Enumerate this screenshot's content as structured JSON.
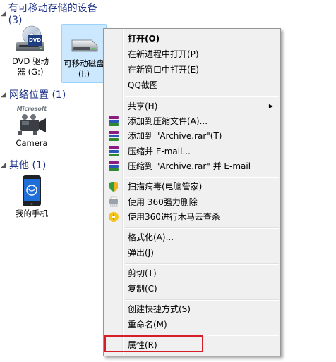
{
  "groups": [
    {
      "id": "removable",
      "label": "有可移动存储的设备 (3)"
    },
    {
      "id": "network",
      "label": "网络位置 (1)"
    },
    {
      "id": "other",
      "label": "其他 (1)"
    }
  ],
  "devices": {
    "dvd": {
      "line1": "DVD 驱动",
      "line2": "器 (G:)",
      "badge": "DVD"
    },
    "removable": {
      "line1": "可移动磁盘",
      "line2": "(I:)"
    },
    "camera": {
      "label": "Camera",
      "logo": "Microsoft"
    },
    "phone": {
      "label": "我的手机"
    }
  },
  "context_menu": {
    "items": {
      "open": "打开(O)",
      "open_new_process": "在新进程中打开(P)",
      "open_new_window": "在新窗口中打开(E)",
      "qq_screenshot": "QQ截图",
      "share": "共享(H)",
      "add_to_archive": "添加到压缩文件(A)...",
      "add_to_archive_rar": "添加到 \"Archive.rar\"(T)",
      "compress_email": "压缩并 E-mail...",
      "compress_rar_email": "压缩到 \"Archive.rar\" 并 E-mail",
      "scan_virus": "扫描病毒(电脑管家)",
      "force_delete_360": "使用 360强力删除",
      "trojan_scan_360": "使用360进行木马云查杀",
      "format": "格式化(A)...",
      "eject": "弹出(J)",
      "cut": "剪切(T)",
      "copy": "复制(C)",
      "create_shortcut": "创建快捷方式(S)",
      "rename": "重命名(M)",
      "properties": "属性(R)"
    }
  },
  "colors": {
    "menu_bg": "#f0f0f0",
    "selection_bg": "#cce8ff",
    "highlight_border": "#d61e28",
    "group_header": "#1e3287"
  }
}
